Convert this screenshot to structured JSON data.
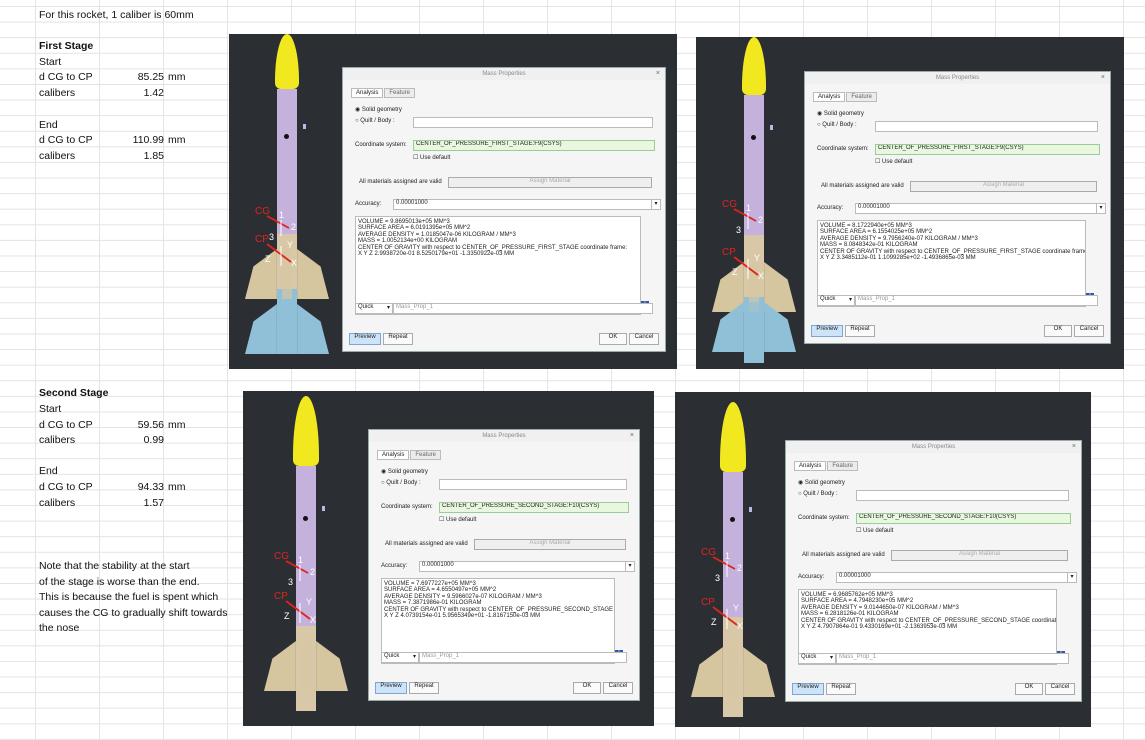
{
  "sheet": {
    "header": "For this rocket, 1 caliber is 60mm",
    "first_stage": {
      "title": "First Stage",
      "start_label": "Start",
      "start_dcg_label": "d CG to CP",
      "start_dcg_value": "85.25",
      "start_dcg_unit": "mm",
      "start_cal_label": "calibers",
      "start_cal_value": "1.42",
      "end_label": "End",
      "end_dcg_label": "d CG to CP",
      "end_dcg_value": "110.99",
      "end_dcg_unit": "mm",
      "end_cal_label": "calibers",
      "end_cal_value": "1.85"
    },
    "second_stage": {
      "title": "Second Stage",
      "start_label": "Start",
      "start_dcg_label": "d CG to CP",
      "start_dcg_value": "59.56",
      "start_dcg_unit": "mm",
      "start_cal_label": "calibers",
      "start_cal_value": "0.99",
      "end_label": "End",
      "end_dcg_label": "d CG to CP",
      "end_dcg_value": "94.33",
      "end_dcg_unit": "mm",
      "end_cal_label": "calibers",
      "end_cal_value": "1.57"
    },
    "note_lines": [
      "Note that the stability at the start",
      "of the stage is worse than the end.",
      "This is because the fuel is spent which",
      "causes the CG to gradually shift towards",
      "the nose"
    ]
  },
  "common": {
    "dialog_title": "Mass Properties",
    "tab_analysis": "Analysis",
    "tab_feature": "Feature",
    "solid_geometry": "Solid geometry",
    "quilt_body": "Quilt / Body :",
    "coord_label": "Coordinate system:",
    "use_default": "Use default",
    "materials_valid": "All materials assigned are valid",
    "assign_material": "Assign Material",
    "accuracy_label": "Accuracy:",
    "accuracy_value": "0.00001000",
    "quick": "Quick",
    "mass_prop_placeholder": "Mass_Prop_1",
    "preview": "Preview",
    "repeat": "Repeat",
    "ok": "OK",
    "cancel": "Cancel",
    "close_glyph": "×",
    "dropdown_glyph": "▾",
    "info_glyph": "i",
    "cg": "CG",
    "cp": "CP",
    "axis_1": "1",
    "axis_2": "2",
    "axis_3": "3",
    "axis_x": "X",
    "axis_y": "Y",
    "axis_z": "Z"
  },
  "panels": [
    {
      "csys": "CENTER_OF_PRESSURE_FIRST_STAGE:F9(CSYS)",
      "results": [
        "VOLUME = 9.8695013e+05 MM^3",
        "SURFACE AREA = 6.0191395e+05 MM^2",
        "AVERAGE DENSITY = 1.0185047e-06 KILOGRAM / MM^3",
        "MASS = 1.0052134e+00 KILOGRAM",
        "CENTER OF GRAVITY with respect to CENTER_OF_PRESSURE_FIRST_STAGE coordinate frame:",
        "X  Y  Z   2.9938720e-01  8.5250179e+01 -1.3350922e-03  MM"
      ]
    },
    {
      "csys": "CENTER_OF_PRESSURE_FIRST_STAGE:F9(CSYS)",
      "results": [
        "VOLUME = 8.1722940e+05 MM^3",
        "SURFACE AREA = 6.1554025e+05 MM^2",
        "AVERAGE DENSITY = 9.7956240e-07 KILOGRAM / MM^3",
        "MASS = 8.0848342e-01 KILOGRAM",
        "CENTER OF GRAVITY with respect to CENTER_OF_PRESSURE_FIRST_STAGE coordinate frame:",
        "X  Y  Z   3.3485112e-01  1.1099285e+02 -1.4936865e-03  MM"
      ]
    },
    {
      "csys": "CENTER_OF_PRESSURE_SECOND_STAGE:F10(CSYS)",
      "results": [
        "VOLUME = 7.6977227e+05 MM^3",
        "SURFACE AREA = 4.6550497e+05 MM^2",
        "AVERAGE DENSITY = 9.5966027e-07 KILOGRAM / MM^3",
        "MASS = 7.3871986e-01 KILOGRAM",
        "CENTER OF GRAVITY with respect to CENTER_OF_PRESSURE_SECOND_STAGE coordin",
        "X  Y  Z   4.0739154e-01  5.9565349e+01 -1.8167150e-03  MM"
      ]
    },
    {
      "csys": "CENTER_OF_PRESSURE_SECOND_STAGE:F10(CSYS)",
      "results": [
        "VOLUME = 6.9685762e+05 MM^3",
        "SURFACE AREA = 4.7948230e+05 MM^2",
        "AVERAGE DENSITY = 9.0144650e-07 KILOGRAM / MM^3",
        "MASS = 6.2818126e-01 KILOGRAM",
        "CENTER OF GRAVITY with respect to CENTER_OF_PRESSURE_SECOND_STAGE coordinate frame:",
        "X  Y  Z   4.7907864e-01  9.4330169e+01 -2.1363953e-03  MM"
      ]
    }
  ]
}
